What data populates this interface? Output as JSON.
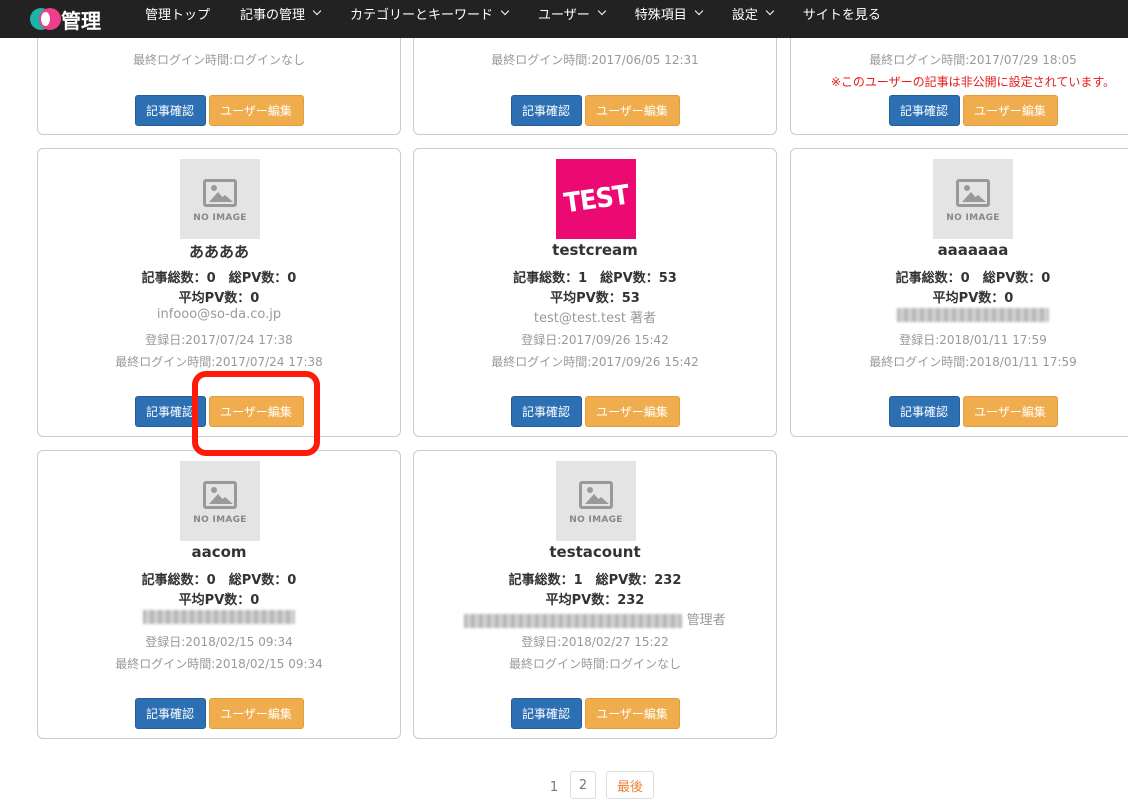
{
  "app": {
    "logo_text": "管理"
  },
  "nav": {
    "items": [
      {
        "label": "管理トップ",
        "dropdown": false
      },
      {
        "label": "記事の管理",
        "dropdown": true
      },
      {
        "label": "カテゴリーとキーワード",
        "dropdown": true
      },
      {
        "label": "ユーザー",
        "dropdown": true
      },
      {
        "label": "特殊項目",
        "dropdown": true
      },
      {
        "label": "設定",
        "dropdown": true
      },
      {
        "label": "サイトを見る",
        "dropdown": false
      }
    ]
  },
  "buttons": {
    "articles": "記事確認",
    "edit": "ユーザー編集"
  },
  "cards_top": [
    {
      "meta2": "最終ログイン時間:ログインなし",
      "warning": ""
    },
    {
      "meta2": "最終ログイン時間:2017/06/05 12:31",
      "warning": ""
    },
    {
      "meta2": "最終ログイン時間:2017/07/29 18:05",
      "warning": "※このユーザーの記事は非公開に設定されています。"
    }
  ],
  "cards": [
    {
      "image": "no-image",
      "name": "ああああ",
      "stat1": "記事総数：0　総PV数：0",
      "stat2": "平均PV数：0",
      "email": "infooo@so-da.co.jp",
      "role": "",
      "registered": "登録日:2017/07/24 17:38",
      "last_login": "最終ログイン時間:2017/07/24 17:38"
    },
    {
      "image": "test",
      "name": "testcream",
      "stat1": "記事総数：1　総PV数：53",
      "stat2": "平均PV数：53",
      "email": "test@test.test",
      "role": "著者",
      "registered": "登録日:2017/09/26 15:42",
      "last_login": "最終ログイン時間:2017/09/26 15:42"
    },
    {
      "image": "no-image",
      "name": "aaaaaaa",
      "stat1": "記事総数：0　総PV数：0",
      "stat2": "平均PV数：0",
      "email": "",
      "role": "",
      "registered": "登録日:2018/01/11 17:59",
      "last_login": "最終ログイン時間:2018/01/11 17:59"
    },
    {
      "image": "no-image",
      "name": "aacom",
      "stat1": "記事総数：0　総PV数：0",
      "stat2": "平均PV数：0",
      "email": "",
      "role": "",
      "registered": "登録日:2018/02/15 09:34",
      "last_login": "最終ログイン時間:2018/02/15 09:34"
    },
    {
      "image": "no-image",
      "name": "testacount",
      "stat1": "記事総数：1　総PV数：232",
      "stat2": "平均PV数：232",
      "email": "",
      "role": "管理者",
      "registered": "登録日:2018/02/27 15:22",
      "last_login": "最終ログイン時間:ログインなし"
    }
  ],
  "noimage_label": "NO IMAGE",
  "test_image_text": "TEST",
  "pagination": {
    "current": "1",
    "page2": "2",
    "last": "最後"
  },
  "colors": {
    "primary": "#2d6fb3",
    "warning": "#f0ad4e",
    "highlight": "#ff1a0a",
    "topbar": "#222222"
  }
}
